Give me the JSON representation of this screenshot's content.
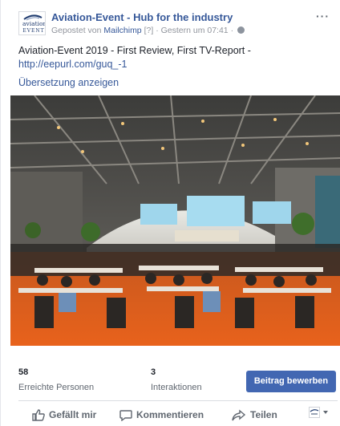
{
  "post": {
    "page_name": "Aviation-Event - Hub for the industry",
    "logo_text": "aviation EVENT",
    "posted_via_prefix": "Gepostet von",
    "posted_via_app": "Mailchimp",
    "posted_via_badge": "[?]",
    "timestamp": "· Gestern um 07:41 ·",
    "text": "Aviation-Event 2019 - First Review, First TV-Report - ",
    "link": "http://eepurl.com/guq_-1",
    "translate_label": "Übersetzung anzeigen",
    "more_icon": "more-horizontal-icon"
  },
  "stats": {
    "reach_count": "58",
    "reach_label": "Erreichte Personen",
    "interactions_count": "3",
    "interactions_label": "Interaktionen",
    "boost_label": "Beitrag bewerben",
    "boost_color": "#4267b2"
  },
  "actions": {
    "like_label": "Gefällt mir",
    "comment_label": "Kommentieren",
    "share_label": "Teilen"
  }
}
